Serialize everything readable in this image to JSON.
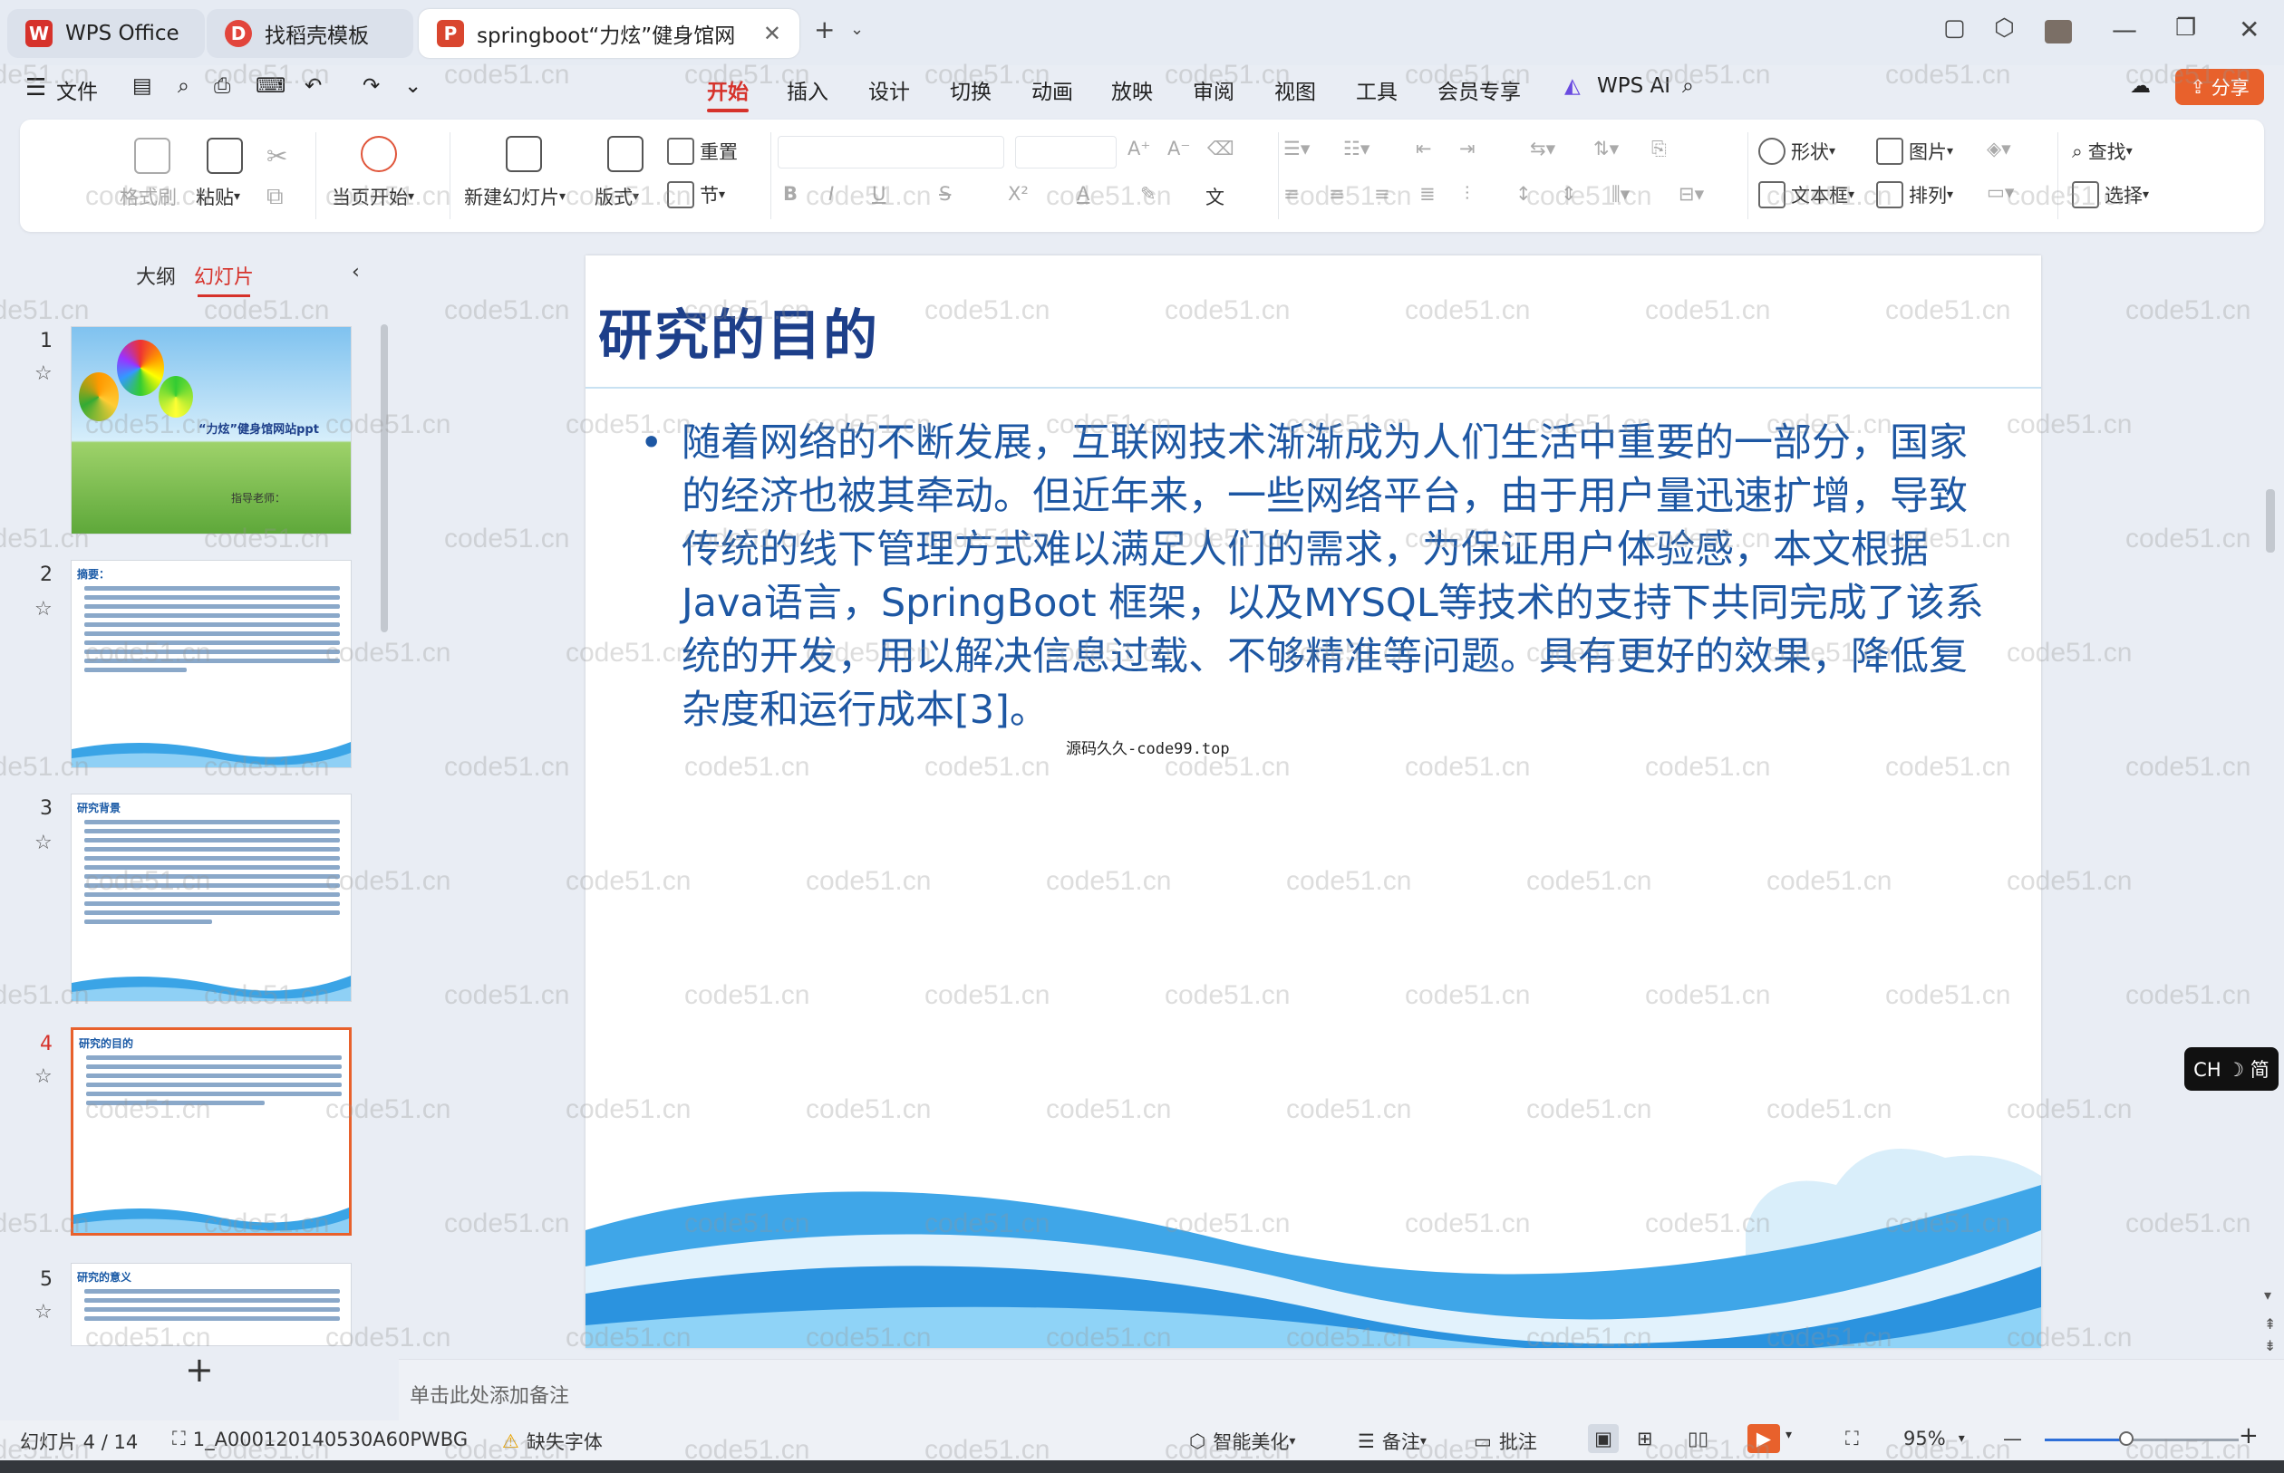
{
  "titlebar": {
    "tabs": [
      {
        "label": "WPS Office",
        "logo": "W",
        "color": "#d6322b"
      },
      {
        "label": "找稻壳模板",
        "logo": "D",
        "color": "#e2453c"
      },
      {
        "label": "springboot“力炫”健身馆网",
        "logo": "P",
        "color": "#d9462f"
      }
    ],
    "new_tab": "+"
  },
  "menu": {
    "file": "文件",
    "items": [
      "开始",
      "插入",
      "设计",
      "切换",
      "动画",
      "放映",
      "审阅",
      "视图",
      "工具",
      "会员专享"
    ],
    "wps_ai": "WPS AI",
    "share": "分享"
  },
  "ribbon": {
    "format_painter": "格式刷",
    "paste": "粘贴",
    "play_from_current": "当页开始",
    "new_slide": "新建幻灯片",
    "layout": "版式",
    "section": "节",
    "reset": "重置",
    "bold": "B",
    "italic": "I",
    "underline": "U",
    "strike": "S",
    "superscript": "X²",
    "font_color": "A",
    "shape": "形状",
    "picture": "图片",
    "textbox": "文本框",
    "arrange": "排列",
    "find": "查找",
    "select": "选择"
  },
  "left_panel": {
    "tab_outline": "大纲",
    "tab_slides": "幻灯片",
    "slides": [
      {
        "num": "1",
        "title": "“力炫”健身馆网站ppt",
        "subtitle": "指导老师："
      },
      {
        "num": "2",
        "title": "摘要："
      },
      {
        "num": "3",
        "title": "研究背景"
      },
      {
        "num": "4",
        "title": "研究的目的"
      },
      {
        "num": "5",
        "title": "研究的意义"
      }
    ],
    "add_slide": "+"
  },
  "slide": {
    "title": "研究的目的",
    "bullet": "随着网络的不断发展，互联网技术渐渐成为人们生活中重要的一部分，国家的经济也被其牵动。但近年来，一些网络平台，由于用户量迅速扩增，导致传统的线下管理方式难以满足人们的需求，为保证用户体验感，本文根据Java语言，SpringBoot 框架，以及MYSQL等技术的支持下共同完成了该系统的开发，用以解决信息过载、不够精准等问题。具有更好的效果，降低复杂度和运行成本[3]。",
    "source": "源码久久-code99.top"
  },
  "watermark": "code51.cn",
  "notes_placeholder": "单击此处添加备注",
  "status": {
    "slide_counter": "幻灯片 4 / 14",
    "template": "1_A000120140530A60PWBG",
    "missing_font": "缺失字体",
    "smart_beautify": "智能美化",
    "notes": "备注",
    "comments": "批注",
    "zoom": "95%"
  },
  "ime": "CH ☽ 简"
}
